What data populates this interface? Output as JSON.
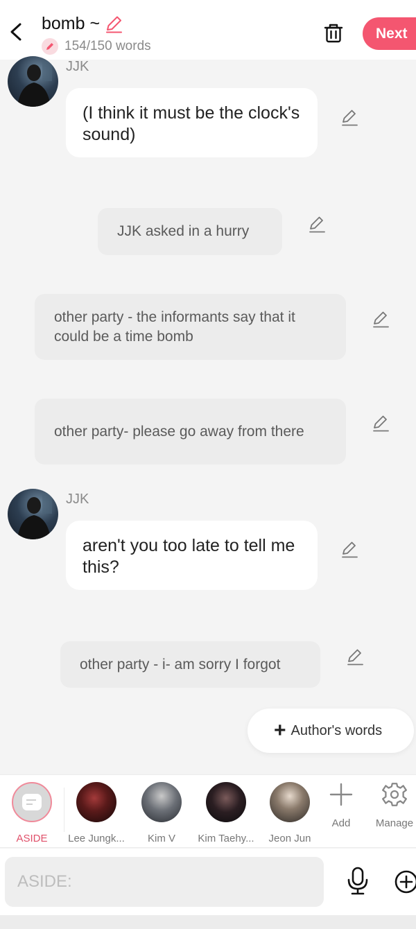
{
  "header": {
    "title": "bomb ~",
    "word_count": "154/150 words",
    "next_label": "Next"
  },
  "messages": [
    {
      "type": "character",
      "speaker": "JJK",
      "text": "(I think it must be the clock's sound)"
    },
    {
      "type": "narration",
      "text": "JJK asked in a hurry"
    },
    {
      "type": "narration",
      "text": "other party - the informants say that it could be a time bomb"
    },
    {
      "type": "narration",
      "text": "other party- please go away from there"
    },
    {
      "type": "character",
      "speaker": "JJK",
      "text": "aren't you too late to tell me this?"
    },
    {
      "type": "narration",
      "text": "other party - i- am sorry I forgot"
    }
  ],
  "author_button": {
    "label": "Author's words"
  },
  "characters": [
    {
      "name": "ASIDE",
      "icon": "aside-icon"
    },
    {
      "name": "Lee Jungk..."
    },
    {
      "name": "Kim V"
    },
    {
      "name": "Kim Taehy..."
    },
    {
      "name": "Jeon Jun"
    }
  ],
  "tools": {
    "add_label": "Add",
    "manage_label": "Manage"
  },
  "input": {
    "placeholder": "ASIDE:"
  },
  "colors": {
    "accent": "#f45670",
    "aside_ring": "#f08a9a",
    "bubble": "#ffffff",
    "narration_bg": "#ececec",
    "page_bg": "#f4f4f4"
  }
}
